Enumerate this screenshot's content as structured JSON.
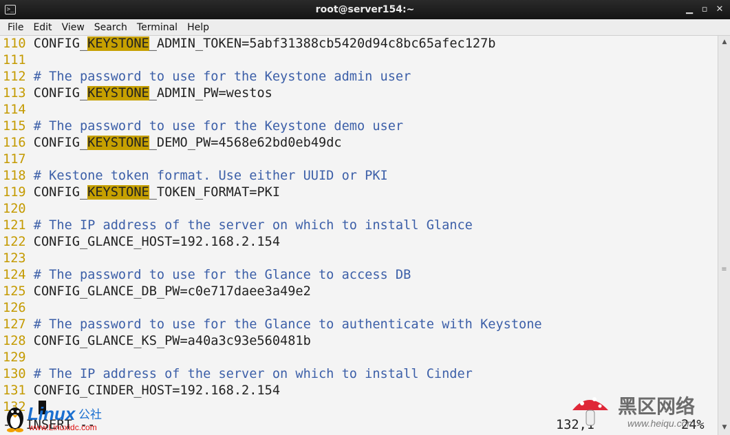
{
  "window": {
    "title": "root@server154:~",
    "icon": "terminal-icon",
    "controls": [
      "minimize-icon",
      "maximize-icon",
      "close-icon"
    ]
  },
  "menu": [
    "File",
    "Edit",
    "View",
    "Search",
    "Terminal",
    "Help"
  ],
  "lines": [
    {
      "num": "110",
      "type": "code",
      "pre": "CONFIG_",
      "hl": "KEYSTONE",
      "post": "_ADMIN_TOKEN=5abf31388cb5420d94c8bc65afec127b"
    },
    {
      "num": "111",
      "type": "blank",
      "text": ""
    },
    {
      "num": "112",
      "type": "comment",
      "text": "# The password to use for the Keystone admin user"
    },
    {
      "num": "113",
      "type": "code",
      "pre": "CONFIG_",
      "hl": "KEYSTONE",
      "post": "_ADMIN_PW=westos"
    },
    {
      "num": "114",
      "type": "blank",
      "text": ""
    },
    {
      "num": "115",
      "type": "comment",
      "text": "# The password to use for the Keystone demo user"
    },
    {
      "num": "116",
      "type": "code",
      "pre": "CONFIG_",
      "hl": "KEYSTONE",
      "post": "_DEMO_PW=4568e62bd0eb49dc"
    },
    {
      "num": "117",
      "type": "blank",
      "text": ""
    },
    {
      "num": "118",
      "type": "comment",
      "text": "# Kestone token format. Use either UUID or PKI"
    },
    {
      "num": "119",
      "type": "code",
      "pre": "CONFIG_",
      "hl": "KEYSTONE",
      "post": "_TOKEN_FORMAT=PKI"
    },
    {
      "num": "120",
      "type": "blank",
      "text": ""
    },
    {
      "num": "121",
      "type": "comment",
      "text": "# The IP address of the server on which to install Glance"
    },
    {
      "num": "122",
      "type": "plain",
      "text": "CONFIG_GLANCE_HOST=192.168.2.154"
    },
    {
      "num": "123",
      "type": "blank",
      "text": ""
    },
    {
      "num": "124",
      "type": "comment",
      "text": "# The password to use for the Glance to access DB"
    },
    {
      "num": "125",
      "type": "plain",
      "text": "CONFIG_GLANCE_DB_PW=c0e717daee3a49e2"
    },
    {
      "num": "126",
      "type": "blank",
      "text": ""
    },
    {
      "num": "127",
      "type": "comment",
      "text": "# The password to use for the Glance to authenticate with Keystone"
    },
    {
      "num": "128",
      "type": "plain",
      "text": "CONFIG_GLANCE_KS_PW=a40a3c93e560481b"
    },
    {
      "num": "129",
      "type": "blank",
      "text": ""
    },
    {
      "num": "130",
      "type": "comment",
      "text": "# The IP address of the server on which to install Cinder"
    },
    {
      "num": "131",
      "type": "plain",
      "text": "CONFIG_CINDER_HOST=192.168.2.154"
    },
    {
      "num": "132",
      "type": "blank",
      "text": ""
    }
  ],
  "status": {
    "mode": "-- INSERT --",
    "position": "132,1",
    "percent": "24%"
  },
  "colors": {
    "line_number": "#c49a00",
    "comment": "#3c5fa8",
    "highlight": "#c6a000",
    "background": "#f4f4f4"
  },
  "watermarks": {
    "left_brand": "Linux",
    "left_cn": "公社",
    "left_url": "www.Linuxidc.com",
    "right_cn": "黑区网络",
    "right_url": "www.heiqu.com"
  }
}
